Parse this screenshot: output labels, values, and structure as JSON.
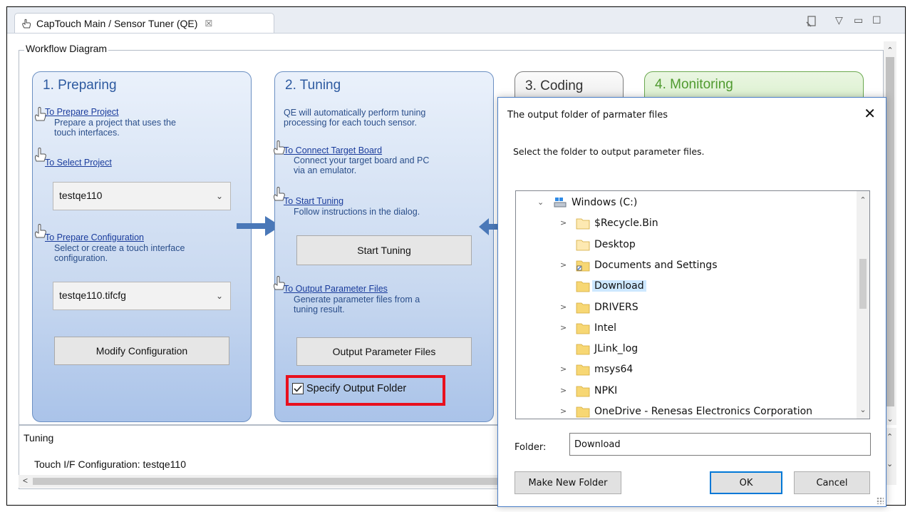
{
  "tab": {
    "title": "CapTouch Main / Sensor Tuner (QE)",
    "close": "☒"
  },
  "workflow_header": "Workflow Diagram",
  "preparing": {
    "title": "1. Preparing",
    "prepare_project_link": "To Prepare Project",
    "prepare_project_desc": [
      "Prepare a project that uses the",
      "touch interfaces."
    ],
    "select_project_link": "To Select Project",
    "project_value": "testqe110",
    "prepare_config_link": "To Prepare Configuration",
    "prepare_config_desc": [
      "Select or create a touch interface",
      "configuration."
    ],
    "config_value": "testqe110.tifcfg",
    "modify_button": "Modify Configuration"
  },
  "tuning": {
    "title": "2. Tuning",
    "intro": [
      "QE will automatically perform tuning",
      "processing for each touch sensor."
    ],
    "connect_link": "To Connect Target Board",
    "connect_desc": [
      "Connect your target board and PC",
      "via an emulator."
    ],
    "start_link": "To Start Tuning",
    "start_desc": [
      "Follow instructions in the dialog."
    ],
    "start_button": "Start Tuning",
    "output_link": "To Output Parameter Files",
    "output_desc": [
      "Generate parameter files from a",
      "tuning result."
    ],
    "output_button": "Output Parameter Files",
    "specify_checkbox": "Specify Output Folder",
    "specify_checked": true,
    "highlight_color": "#e8101e"
  },
  "coding": {
    "title": "3. Coding"
  },
  "monitoring": {
    "title": "4. Monitoring"
  },
  "dialog": {
    "title": "The output folder of parmater files",
    "instruction": "Select the folder to output parameter files.",
    "tree": [
      {
        "label": "Windows (C:)",
        "level": 0,
        "expand": "⌄",
        "icon": "drive-icon"
      },
      {
        "label": "$Recycle.Bin",
        "level": 1,
        "expand": ">",
        "icon": "folder-pale-icon"
      },
      {
        "label": "Desktop",
        "level": 1,
        "expand": "",
        "icon": "folder-pale-icon"
      },
      {
        "label": "Documents and Settings",
        "level": 1,
        "expand": ">",
        "icon": "folder-shortcut-icon"
      },
      {
        "label": "Download",
        "level": 1,
        "expand": "",
        "icon": "folder-icon",
        "selected": true
      },
      {
        "label": "DRIVERS",
        "level": 1,
        "expand": ">",
        "icon": "folder-icon"
      },
      {
        "label": "Intel",
        "level": 1,
        "expand": ">",
        "icon": "folder-icon"
      },
      {
        "label": "JLink_log",
        "level": 1,
        "expand": "",
        "icon": "folder-icon"
      },
      {
        "label": "msys64",
        "level": 1,
        "expand": ">",
        "icon": "folder-icon"
      },
      {
        "label": "NPKI",
        "level": 1,
        "expand": ">",
        "icon": "folder-icon"
      },
      {
        "label": "OneDrive - Renesas Electronics Corporation",
        "level": 1,
        "expand": ">",
        "icon": "folder-icon"
      }
    ],
    "folder_label": "Folder:",
    "folder_value": "Download",
    "make_new_folder": "Make New Folder",
    "ok": "OK",
    "cancel": "Cancel"
  },
  "tuning_section": {
    "title": "Tuning",
    "config_label": "Touch I/F Configuration: testqe110"
  }
}
